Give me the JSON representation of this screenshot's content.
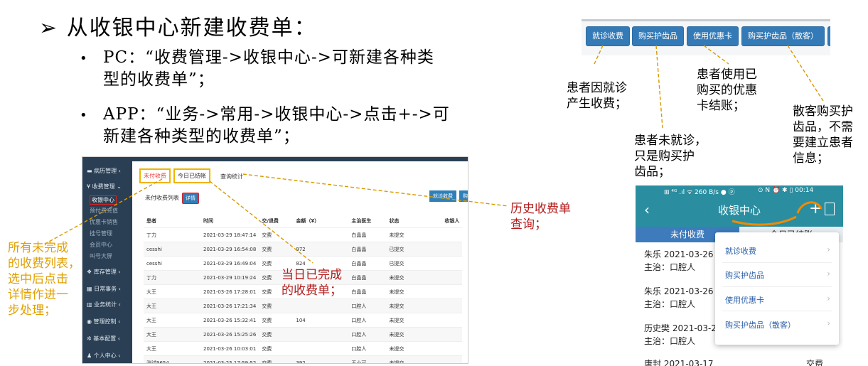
{
  "heading": "从收银中心新建收费单：",
  "heading_marker": "➢",
  "bullets": [
    {
      "line1": "PC：“收费管理->收银中心->可新建各种类",
      "line2": "型的收费单”；"
    },
    {
      "line1": "APP：“业务->常用->收银中心->点击+->可",
      "line2": "新建各种类型的收费单”；"
    }
  ],
  "pc": {
    "sidebar": {
      "ward": "病历管理 ‹",
      "billing": "收费管理 ⌄",
      "subs": [
        "收银中心",
        "预付费充值",
        "优惠卡销售",
        "挂号管理",
        "会员中心",
        "叫号大屏"
      ],
      "stock": "库存管理 ‹",
      "daily": "日常事务 ‹",
      "stats": "业务统计 ‹",
      "mgmt": "管理控制 ‹",
      "base": "基本配置 ‹",
      "personal": "个人中心 ‹"
    },
    "tabs": {
      "unpaid": "未付收费",
      "today": "今日已结帐",
      "query": "查询统计"
    },
    "list_label": "未付收费列表",
    "detail_btn": "详情",
    "visit_btn": "就诊收费",
    "buy_btn": "购",
    "columns": [
      "患者",
      "时间",
      "交/退费",
      "金额（¥）",
      "主治医生",
      "状态",
      "收银人"
    ],
    "rows": [
      [
        "丁力",
        "2021-03-29 18:47:14",
        "交费",
        "",
        "白晶晶",
        "未提交",
        ""
      ],
      [
        "cesshi",
        "2021-03-29 16:54:08",
        "交费",
        "972",
        "白晶晶",
        "已提交",
        ""
      ],
      [
        "cesshi",
        "2021-03-29 16:49:04",
        "交费",
        "824",
        "白晶晶",
        "已提交",
        ""
      ],
      [
        "丁力",
        "2021-03-29 10:19:24",
        "交费",
        "",
        "白晶晶",
        "未提交",
        ""
      ],
      [
        "大王",
        "2021-03-26 17:28:01",
        "交费",
        "",
        "白晶晶",
        "未提交",
        ""
      ],
      [
        "大王",
        "2021-03-26 17:21:34",
        "交费",
        "",
        "口腔人",
        "未提交",
        ""
      ],
      [
        "大王",
        "2021-03-26 15:32:41",
        "交费",
        "104",
        "口腔人",
        "未提交",
        ""
      ],
      [
        "大王",
        "2021-03-26 15:25:26",
        "交费",
        "",
        "口腔人",
        "未提交",
        ""
      ],
      [
        "大王",
        "2021-03-26 10:03:01",
        "交费",
        "",
        "口腔人",
        "未提交",
        ""
      ],
      [
        "测试9654",
        "2021-03-25 17:59:52",
        "交费",
        "392",
        "王小可",
        "未提交",
        ""
      ]
    ]
  },
  "buttons": [
    "就诊收费",
    "购买护齿品",
    "使用优惠卡",
    "购买护齿品（散客）"
  ],
  "mobile": {
    "status_left": "⊞ ⁴ᴳ .ıl ᯤ 260 B/s ● ⓟ",
    "status_right": "⊙ N ⏰ ✱ ▯ 00:14",
    "back": "‹",
    "title": "收银中心",
    "plus": "+",
    "tab_unpaid": "未付收费",
    "tab_today": "今日已结账",
    "rows": [
      {
        "name": "朱乐 2021-03-26",
        "doctor": "主治：口腔人",
        "right": ""
      },
      {
        "name": "朱乐 2021-03-26",
        "doctor": "主治：口腔人",
        "right": ""
      },
      {
        "name": "历史樊 2021-03-25",
        "doctor": "主治：口腔人",
        "right": ""
      },
      {
        "name": "唐封 2021-03-17",
        "doctor": "",
        "right": "交费"
      }
    ],
    "menu": [
      "就诊收费",
      "购买护齿品",
      "使用优惠卡",
      "购买护齿品（散客）"
    ]
  },
  "annotations": {
    "visit": "患者因就诊\n产生收费；",
    "product": "患者未就诊，\n只是购买护\n齿品；",
    "card": "患者使用已\n购买的优惠\n卡结账；",
    "guest": "散客购买护\n齿品，不需\n要建立患者\n信息；",
    "history": "历史收费单\n查询；",
    "today": "当日已完成\n的收费单；",
    "unpaid": "所有未完成\n的收费列表，\n选中后点击\n详情作进一\n步处理；"
  }
}
